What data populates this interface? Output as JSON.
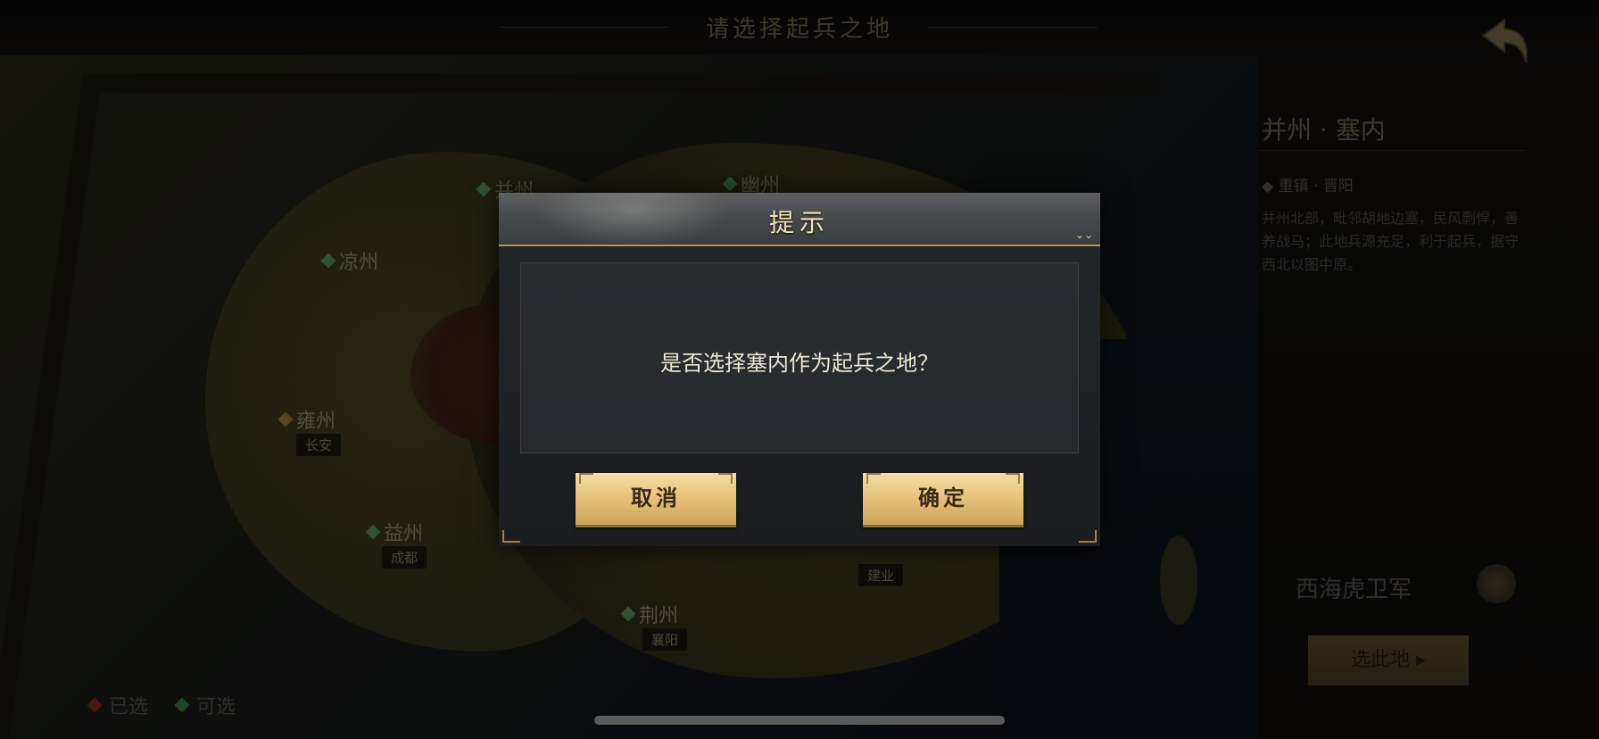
{
  "background": {
    "top_title": "请选择起兵之地",
    "region_title": "并州 · 塞内",
    "region_subtitle": "◆ 重镇 · 晋阳",
    "region_description": "并州北部，毗邻胡地边塞，民风剽悍，善养战马；此地兵源充足，利于起兵，据守西北以图中原。",
    "cities": [
      {
        "name": "凉州",
        "tag": ""
      },
      {
        "name": "雍州",
        "tag": "长安"
      },
      {
        "name": "益州",
        "tag": "成都"
      },
      {
        "name": "荆州",
        "tag": "襄阳"
      },
      {
        "name": "并州",
        "tag": ""
      },
      {
        "name": "幽州",
        "tag": ""
      },
      {
        "name": "",
        "tag": "建业"
      }
    ],
    "army_name": "西海虎卫军",
    "side_button_label": "选此地 ▸",
    "legend": {
      "occupied": "已选",
      "available": "可选"
    }
  },
  "dialog": {
    "title": "提示",
    "message": "是否选择塞内作为起兵之地？",
    "cancel_label": "取消",
    "confirm_label": "确定"
  },
  "colors": {
    "accent_gold": "#e6c47e",
    "title_text": "#f3e2b8",
    "message_text": "#ece6d4",
    "available_marker": "#5ebc6a",
    "occupied_marker": "#a2382a"
  },
  "icons": {
    "back": "back-arrow-icon",
    "city_available": "green-diamond-icon",
    "city_selected": "gold-diamond-icon",
    "army_emblem": "army-emblem-icon"
  }
}
